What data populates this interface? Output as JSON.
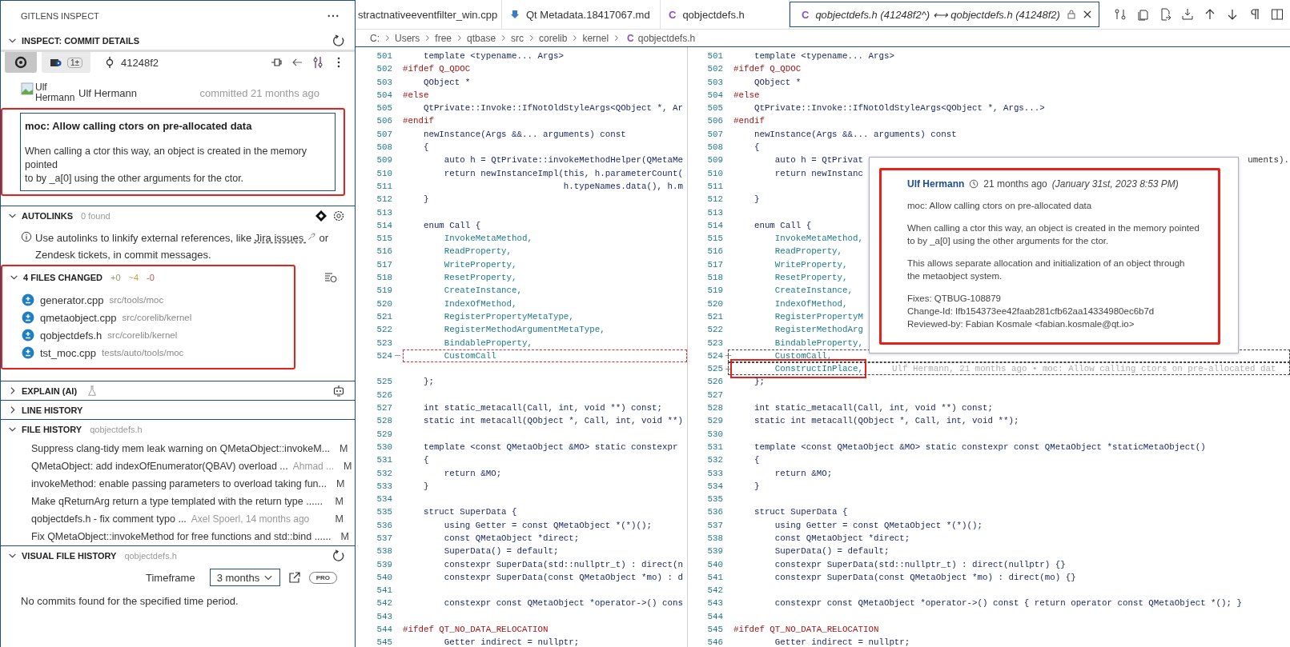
{
  "sidebar": {
    "title": "GITLENS INSPECT",
    "commit_details": {
      "header": "INSPECT: COMMIT DETAILS",
      "expanded": true,
      "tabs": [
        {
          "kind": "commit",
          "selected": true
        },
        {
          "kind": "wip",
          "badge": "1±",
          "selected": false
        }
      ],
      "sha": "41248f2",
      "avatar_alt": "Ulf Hermann",
      "author": "Ulf Hermann",
      "committed": "committed 21 months ago",
      "message": {
        "title": "moc: Allow calling ctors on pre-allocated data",
        "lines": [
          "When calling a ctor this way, an object is created in the memory",
          "pointed",
          "to by _a[0] using the other arguments for the ctor."
        ],
        "annotated": true
      }
    },
    "autolinks": {
      "header": "AUTOLINKS",
      "count": "0 found",
      "expanded": true,
      "text_before": "Use autolinks to linkify external references, like",
      "link": "Jira issues",
      "text_after": "or Zendesk tickets, in commit messages."
    },
    "files": {
      "header": "4 FILES CHANGED",
      "added": "+0",
      "modified": "~4",
      "deleted": "-0",
      "expanded": true,
      "annotated": true,
      "items": [
        {
          "name": "generator.cpp",
          "path": "src/tools/moc"
        },
        {
          "name": "qmetaobject.cpp",
          "path": "src/corelib/kernel"
        },
        {
          "name": "qobjectdefs.h",
          "path": "src/corelib/kernel"
        },
        {
          "name": "tst_moc.cpp",
          "path": "tests/auto/tools/moc"
        }
      ]
    },
    "sections": [
      {
        "header": "EXPLAIN (AI)",
        "expanded": false,
        "kind": "explain"
      },
      {
        "header": "LINE HISTORY",
        "expanded": false,
        "kind": "plain"
      }
    ],
    "file_history": {
      "header": "FILE HISTORY",
      "file": "qobjectdefs.h",
      "expanded": true,
      "items": [
        {
          "message": "Suppress clang-tidy mem leak warning on QMetaObject::invokeM...",
          "status": "M"
        },
        {
          "message": "QMetaObject: add indexOfEnumerator(QBAV) overload ...",
          "description": "Ahmad ...",
          "status": "M"
        },
        {
          "message": "invokeMethod: enable passing parameters to overload taking fun...",
          "status": "M"
        },
        {
          "message": "Make qReturnArg return a type templated with the return type ......",
          "status": "M"
        },
        {
          "message": "qobjectdefs.h - fix comment typo ...",
          "description": "Axel Spoerl, 14 months ago",
          "status": "M"
        },
        {
          "message": "Fix QMetaObject::invokeMethod for free functions and std::bind ......",
          "status": "M"
        }
      ]
    },
    "visual_history": {
      "header": "VISUAL FILE HISTORY",
      "file": "qobjectdefs.h",
      "expanded": true,
      "timeframe_label": "Timeframe",
      "timeframe": "3 months",
      "badge": "PRO",
      "empty": "No commits found for the specified time period."
    }
  },
  "editor": {
    "tabs": [
      {
        "label": "stractnativeeventfilter_win.cpp",
        "kind": "plain",
        "selected": false
      },
      {
        "label": "Qt Metadata.18417067.md",
        "kind": "download",
        "selected": false
      },
      {
        "label": "qobjectdefs.h",
        "kind": "letter",
        "letter": "C",
        "selected": false
      },
      {
        "label": "qobjectdefs.h (41248f2^) ⟷ qobjectdefs.h (41248f2)",
        "kind": "letter",
        "letter": "C",
        "selected": true,
        "locked": true
      }
    ],
    "breadcrumb": [
      "C:",
      "Users",
      "free",
      "qtbase",
      "src",
      "corelib",
      "kernel"
    ],
    "breadcrumb_file": {
      "letter": "C",
      "name": "qobjectdefs.h"
    },
    "left_lines": [
      {
        "num": "501",
        "text": "    template <typename... Args>",
        "kind": "plain"
      },
      {
        "num": "502",
        "text": "#ifdef Q_QDOC",
        "kind": "directive"
      },
      {
        "num": "503",
        "text": "    QObject *",
        "kind": "plain"
      },
      {
        "num": "504",
        "text": "#else",
        "kind": "directive"
      },
      {
        "num": "505",
        "text": "    QtPrivate::Invoke::IfNotOldStyleArgs<QObject *, Ar",
        "kind": "plain"
      },
      {
        "num": "506",
        "text": "#endif",
        "kind": "directive"
      },
      {
        "num": "507",
        "text": "    newInstance(Args &&... arguments) const",
        "kind": "plain"
      },
      {
        "num": "508",
        "text": "    {",
        "kind": "plain"
      },
      {
        "num": "509",
        "text": "        auto h = QtPrivate::invokeMethodHelper(QMetaMe",
        "kind": "plain"
      },
      {
        "num": "510",
        "text": "        return newInstanceImpl(this, h.parameterCount(",
        "kind": "plain"
      },
      {
        "num": "511",
        "text": "                               h.typeNames.data(), h.m",
        "kind": "plain"
      },
      {
        "num": "512",
        "text": "    }",
        "kind": "plain"
      },
      {
        "num": "513"
      },
      {
        "num": "514",
        "text": "    enum Call {",
        "kind": "plain"
      },
      {
        "num": "515",
        "text": "        InvokeMetaMethod,",
        "kind": "member"
      },
      {
        "num": "516",
        "text": "        ReadProperty,",
        "kind": "member"
      },
      {
        "num": "517",
        "text": "        WriteProperty,",
        "kind": "member"
      },
      {
        "num": "518",
        "text": "        ResetProperty,",
        "kind": "member"
      },
      {
        "num": "519",
        "text": "        CreateInstance,",
        "kind": "member"
      },
      {
        "num": "520",
        "text": "        IndexOfMethod,",
        "kind": "member"
      },
      {
        "num": "521",
        "text": "        RegisterPropertyMetaType,",
        "kind": "member"
      },
      {
        "num": "522",
        "text": "        RegisterMethodArgumentMetaType,",
        "kind": "member"
      },
      {
        "num": "523",
        "text": "        BindableProperty,",
        "kind": "member"
      },
      {
        "num": "524",
        "text": "        CustomCall",
        "kind": "member",
        "removed": true
      },
      {
        "kind": "filler"
      },
      {
        "num": "525",
        "text": "    };",
        "kind": "plain"
      },
      {
        "num": "526"
      },
      {
        "num": "527",
        "text": "    int static_metacall(Call, int, void **) const;",
        "kind": "plain"
      },
      {
        "num": "528",
        "text": "    static int metacall(QObject *, Call, int, void **)",
        "kind": "plain"
      },
      {
        "num": "529"
      },
      {
        "num": "530",
        "text": "    template <const QMetaObject &MO> static constexpr",
        "kind": "plain"
      },
      {
        "num": "531",
        "text": "    {",
        "kind": "plain"
      },
      {
        "num": "532",
        "text": "        return &MO;",
        "kind": "plain"
      },
      {
        "num": "533",
        "text": "    }",
        "kind": "plain"
      },
      {
        "num": "534"
      },
      {
        "num": "535",
        "text": "    struct SuperData {",
        "kind": "plain"
      },
      {
        "num": "536",
        "text": "        using Getter = const QMetaObject *(*)();",
        "kind": "plain"
      },
      {
        "num": "537",
        "text": "        const QMetaObject *direct;",
        "kind": "plain"
      },
      {
        "num": "538",
        "text": "        SuperData() = default;",
        "kind": "plain"
      },
      {
        "num": "539",
        "text": "        constexpr SuperData(std::nullptr_t) : direct(n",
        "kind": "plain"
      },
      {
        "num": "540",
        "text": "        constexpr SuperData(const QMetaObject *mo) : d",
        "kind": "plain"
      },
      {
        "num": "541"
      },
      {
        "num": "542",
        "text": "        constexpr const QMetaObject *operator->() cons",
        "kind": "plain"
      },
      {
        "num": "543"
      },
      {
        "num": "544",
        "text": "#ifdef QT_NO_DATA_RELOCATION",
        "kind": "directive"
      },
      {
        "num": "545",
        "text": "        Getter indirect = nullptr;",
        "kind": "plain"
      }
    ],
    "right_lines": [
      {
        "num": "501",
        "text": "    template <typename... Args>",
        "kind": "plain"
      },
      {
        "num": "502",
        "text": "#ifdef Q_QDOC",
        "kind": "directive"
      },
      {
        "num": "503",
        "text": "    QObject *",
        "kind": "plain"
      },
      {
        "num": "504",
        "text": "#else",
        "kind": "directive"
      },
      {
        "num": "505",
        "text": "    QtPrivate::Invoke::IfNotOldStyleArgs<QObject *, Args...>",
        "kind": "plain"
      },
      {
        "num": "506",
        "text": "#endif",
        "kind": "directive"
      },
      {
        "num": "507",
        "text": "    newInstance(Args &&... arguments) const",
        "kind": "plain"
      },
      {
        "num": "508",
        "text": "    {",
        "kind": "plain"
      },
      {
        "num": "509",
        "text": "        auto h = QtPrivat",
        "kind": "plain",
        "tail": "uments)."
      },
      {
        "num": "510",
        "text": "        return newInstanc",
        "kind": "plain"
      },
      {
        "num": "511"
      },
      {
        "num": "512",
        "text": "    }",
        "kind": "plain"
      },
      {
        "num": "513"
      },
      {
        "num": "514",
        "text": "    enum Call {",
        "kind": "plain"
      },
      {
        "num": "515",
        "text": "        InvokeMetaMethod,",
        "kind": "member"
      },
      {
        "num": "516",
        "text": "        ReadProperty,",
        "kind": "member"
      },
      {
        "num": "517",
        "text": "        WriteProperty,",
        "kind": "member"
      },
      {
        "num": "518",
        "text": "        ResetProperty,",
        "kind": "member"
      },
      {
        "num": "519",
        "text": "        CreateInstance,",
        "kind": "member"
      },
      {
        "num": "520",
        "text": "        IndexOfMethod,",
        "kind": "member"
      },
      {
        "num": "521",
        "text": "        RegisterPropertyM",
        "kind": "member"
      },
      {
        "num": "522",
        "text": "        RegisterMethodArg",
        "kind": "member"
      },
      {
        "num": "523",
        "text": "        BindableProperty,",
        "kind": "member"
      },
      {
        "num": "524",
        "text": "        CustomCall,",
        "kind": "member",
        "added": true
      },
      {
        "num": "525",
        "text": "        ConstructInPlace,",
        "kind": "member",
        "added": true,
        "annotated": true,
        "blame": "Ulf Hermann, 21 months ago • moc: Allow calling ctors on pre-allocated dat"
      },
      {
        "num": "526",
        "text": "    };",
        "kind": "plain"
      },
      {
        "num": "527"
      },
      {
        "num": "528",
        "text": "    int static_metacall(Call, int, void **) const;",
        "kind": "plain"
      },
      {
        "num": "529",
        "text": "    static int metacall(QObject *, Call, int, void **);",
        "kind": "plain"
      },
      {
        "num": "530"
      },
      {
        "num": "531",
        "text": "    template <const QMetaObject &MO> static constexpr const QMetaObject *staticMetaObject()",
        "kind": "plain"
      },
      {
        "num": "532",
        "text": "    {",
        "kind": "plain"
      },
      {
        "num": "533",
        "text": "        return &MO;",
        "kind": "plain"
      },
      {
        "num": "534",
        "text": "    }",
        "kind": "plain"
      },
      {
        "num": "535"
      },
      {
        "num": "536",
        "text": "    struct SuperData {",
        "kind": "plain"
      },
      {
        "num": "537",
        "text": "        using Getter = const QMetaObject *(*)();",
        "kind": "plain"
      },
      {
        "num": "538",
        "text": "        const QMetaObject *direct;",
        "kind": "plain"
      },
      {
        "num": "539",
        "text": "        SuperData() = default;",
        "kind": "plain"
      },
      {
        "num": "540",
        "text": "        constexpr SuperData(std::nullptr_t) : direct(nullptr) {}",
        "kind": "plain"
      },
      {
        "num": "541",
        "text": "        constexpr SuperData(const QMetaObject *mo) : direct(mo) {}",
        "kind": "plain"
      },
      {
        "num": "542"
      },
      {
        "num": "543",
        "text": "        constexpr const QMetaObject *operator->() const { return operator const QMetaObject *(); }",
        "kind": "plain"
      },
      {
        "num": "544"
      },
      {
        "num": "545",
        "text": "#ifdef QT_NO_DATA_RELOCATION",
        "kind": "directive"
      },
      {
        "num": "546",
        "text": "        Getter indirect = nullptr;",
        "kind": "plain"
      }
    ],
    "hover": {
      "author": "Ulf Hermann",
      "time": "21 months ago",
      "date": "(January 31st, 2023 8:53 PM)",
      "annotated": true,
      "paragraphs": [
        [
          "moc: Allow calling ctors on pre-allocated data"
        ],
        [
          "When calling a ctor this way, an object is created in the memory pointed",
          "to by _a[0] using the other arguments for the ctor."
        ],
        [
          "This allows separate allocation and initialization of an object through",
          "the metaobject system."
        ],
        [
          "Fixes: QTBUG-108879",
          "Change-Id: Ifb154373ee42faab281cfb62aa14334980ec6b7d",
          "Reviewed-by: Fabian Kosmale <fabian.kosmale@qt.io>"
        ]
      ]
    }
  }
}
